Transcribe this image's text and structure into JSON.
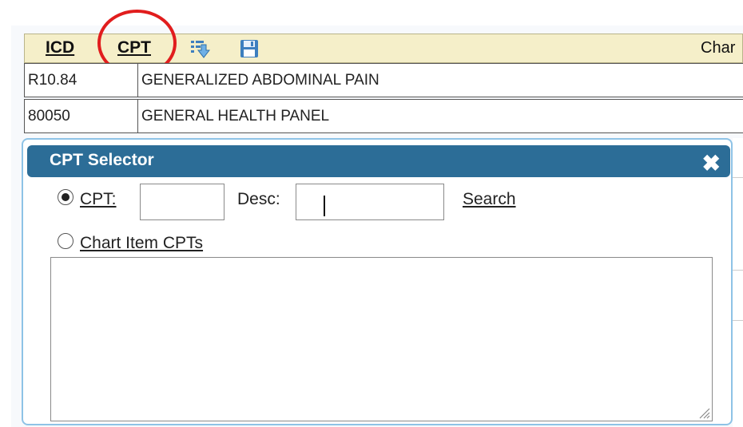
{
  "header": {
    "icd_label": "ICD",
    "cpt_label": "CPT",
    "right_text": "Char",
    "icons": [
      "download-icon",
      "save-disk-icon"
    ]
  },
  "rows": [
    {
      "code": "R10.84",
      "desc": "GENERALIZED ABDOMINAL PAIN"
    },
    {
      "code": "80050",
      "desc": "GENERAL HEALTH PANEL"
    }
  ],
  "dialog": {
    "title": "CPT Selector",
    "close_symbol": "✖",
    "cpt_label": "CPT:",
    "cpt_value": "",
    "desc_label": "Desc:",
    "desc_value": "",
    "search_label": "Search",
    "chart_items_label": "Chart Item CPTs",
    "selected_option": "CPT"
  },
  "colors": {
    "header_bg": "#f5efc9",
    "dialog_title_bg": "#2c6d97",
    "dialog_border": "#8ec3e6",
    "annotation_circle": "#e11d1d"
  }
}
